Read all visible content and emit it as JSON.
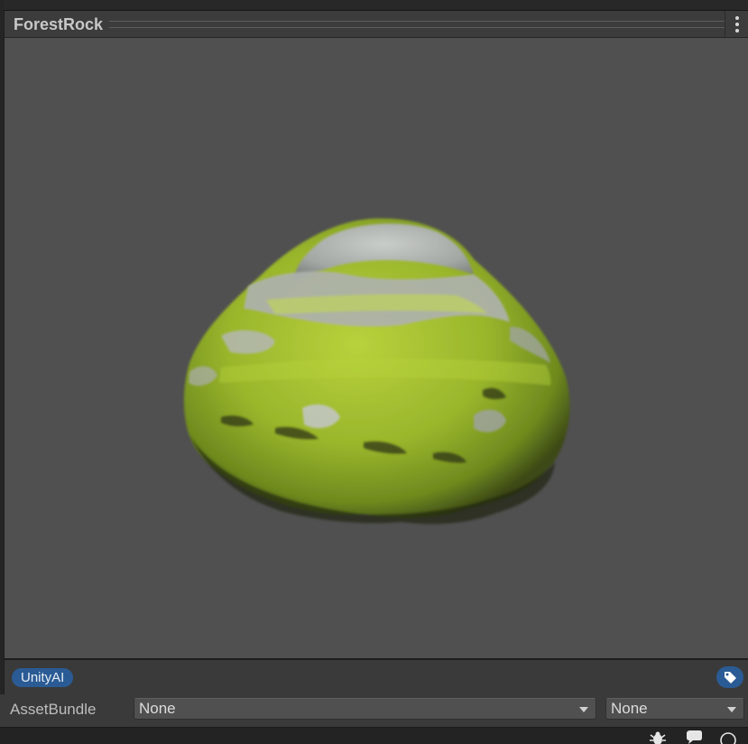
{
  "asset": {
    "name": "ForestRock"
  },
  "labels": {
    "tags": [
      "UnityAI"
    ],
    "tag_icon": "tag-icon"
  },
  "asset_bundle": {
    "label": "AssetBundle",
    "name_value": "None",
    "variant_value": "None"
  },
  "icons": {
    "menu": "vertical-ellipsis-icon",
    "status": [
      "bug-icon",
      "chat-bubble-icon",
      "circle-icon"
    ]
  },
  "colors": {
    "panel_background": "#3c3c3c",
    "preview_background": "#505050",
    "tag_pill": "#2a5b94",
    "moss": "#9dbb2d",
    "rock": "#a9aeaa"
  }
}
